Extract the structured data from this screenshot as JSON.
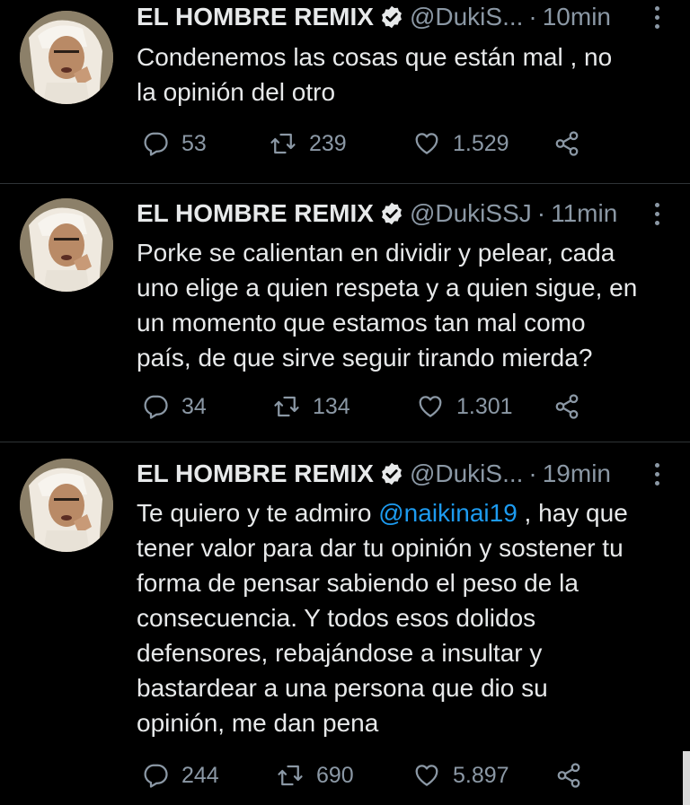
{
  "tweets": [
    {
      "name": "EL HOMBRE REMIX",
      "handle": "@DukiS...",
      "time": "10min",
      "text_lines": [
        "Condenemos las cosas que están mal , no",
        "la opinión del otro"
      ],
      "replies": "53",
      "retweets": "239",
      "likes": "1.529"
    },
    {
      "name": "EL HOMBRE REMIX",
      "handle": "@DukiSSJ",
      "time": "11min",
      "text_lines": [
        "Porke se calientan en dividir y pelear, cada",
        "uno elige a quien respeta y a quien sigue, en",
        "un momento que estamos tan mal como",
        "país, de que sirve seguir tirando mierda?"
      ],
      "replies": "34",
      "retweets": "134",
      "likes": "1.301"
    },
    {
      "name": "EL HOMBRE REMIX",
      "handle": "@DukiS...",
      "time": "19min",
      "text_first_pre": "Te quiero y te admiro ",
      "mention": "@naikinai19",
      "text_first_post": " , hay que",
      "text_lines": [
        "tener valor para dar tu opinión y sostener tu",
        "forma de pensar sabiendo el peso de la",
        "consecuencia. Y todos esos dolidos",
        "defensores, rebajándose a insultar y",
        "bastardear a una persona que dio su",
        "opinión, me dan pena"
      ],
      "replies": "244",
      "retweets": "690",
      "likes": "5.897"
    }
  ],
  "separator": "·",
  "colors": {
    "background": "#000000",
    "text": "#e7e9ea",
    "muted": "#8b98a5",
    "link": "#1d9bf0",
    "divider": "#2f3336"
  }
}
